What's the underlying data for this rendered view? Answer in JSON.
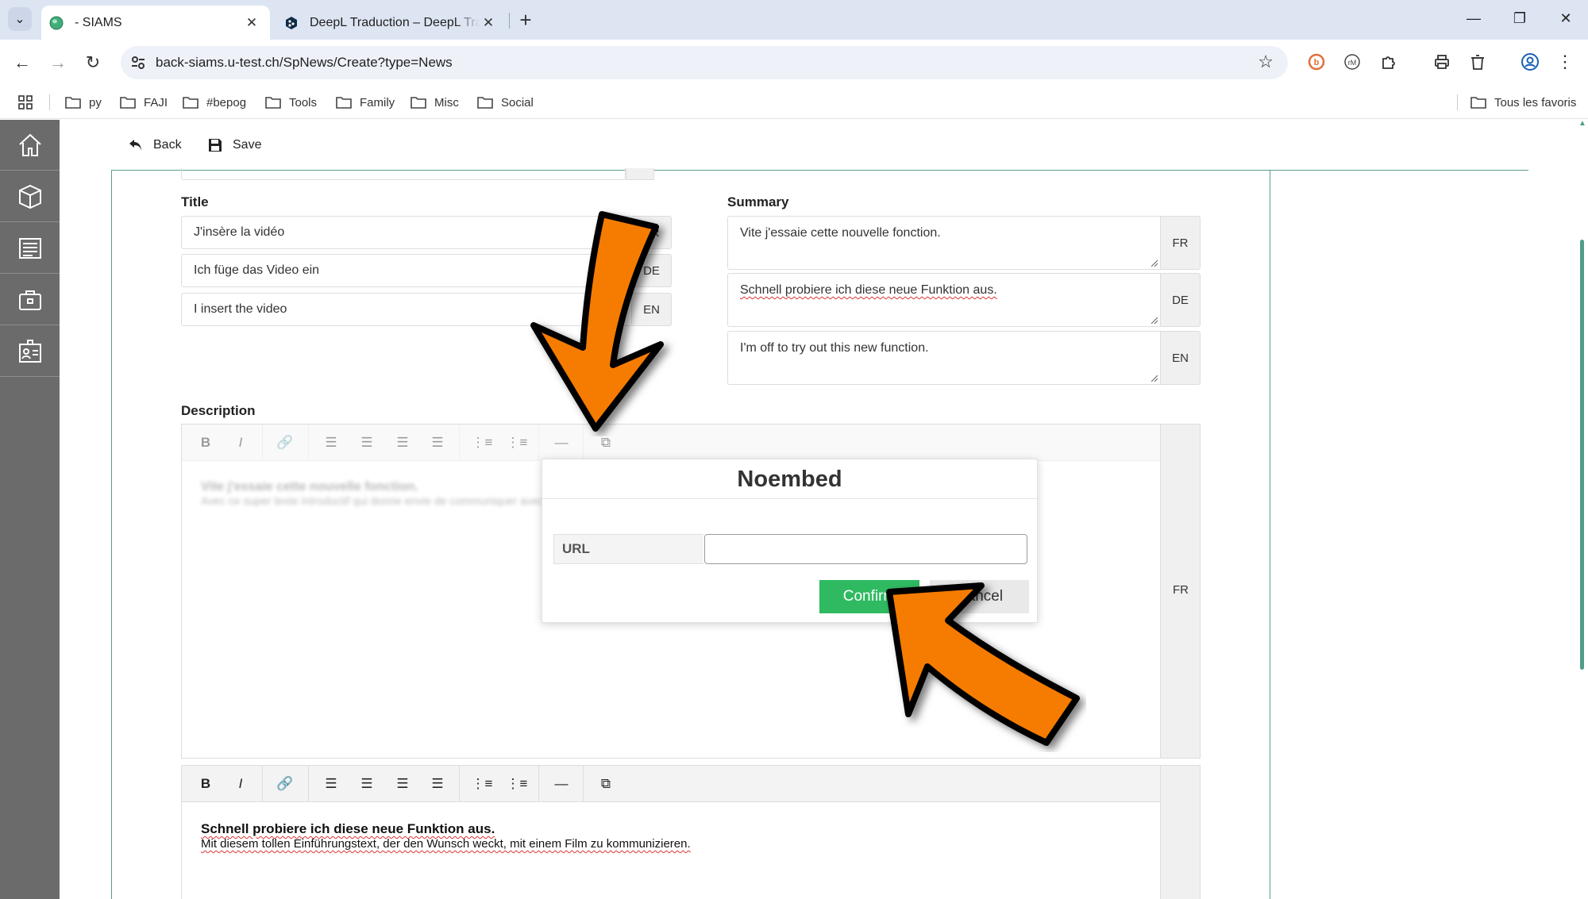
{
  "browser": {
    "tabs": [
      {
        "title": "- SIAMS",
        "active": true,
        "favicon": "globe-green-icon"
      },
      {
        "title": "DeepL Traduction – DeepL Translate",
        "active": false,
        "favicon": "deepl-icon"
      }
    ],
    "url": "back-siams.u-test.ch/SpNews/Create?type=News",
    "bookmarks": [
      "py",
      "FAJI",
      "#bepog",
      "Tools",
      "Family",
      "Misc",
      "Social"
    ],
    "all_bookmarks_label": "Tous les favoris"
  },
  "actions": {
    "back_label": "Back",
    "save_label": "Save"
  },
  "form": {
    "title_label": "Title",
    "titles": [
      {
        "value": "J'insère la vidéo",
        "lang": "FR"
      },
      {
        "value": "Ich füge das Video ein",
        "lang": "DE"
      },
      {
        "value": "I insert the video",
        "lang": "EN"
      }
    ],
    "summary_label": "Summary",
    "summaries": [
      {
        "value": "Vite j'essaie cette nouvelle fonction.",
        "lang": "FR"
      },
      {
        "value": "Schnell probiere ich diese neue Funktion aus.",
        "lang": "DE"
      },
      {
        "value": "I'm off to try out this new function.",
        "lang": "EN"
      }
    ],
    "description_label": "Description",
    "desc_fr_lang": "FR",
    "desc_fr_line1": "Vite j'essaie cette nouvelle fonction.",
    "desc_fr_line2": "Avec ce super texte introductif qui donne envie de communiquer avec un film.",
    "desc_de_line1": "Schnell probiere ich diese neue Funktion aus.",
    "desc_de_line2": "Mit diesem tollen Einführungstext, der den Wunsch weckt, mit einem Film zu kommunizieren."
  },
  "modal": {
    "title": "Noembed",
    "url_label": "URL",
    "url_value": "",
    "confirm_label": "Confirm",
    "cancel_label": "Cancel"
  },
  "colors": {
    "accent": "#5a9e90",
    "confirm": "#2fba61",
    "arrow": "#f57c00",
    "sidenav": "#6b6b6b"
  }
}
